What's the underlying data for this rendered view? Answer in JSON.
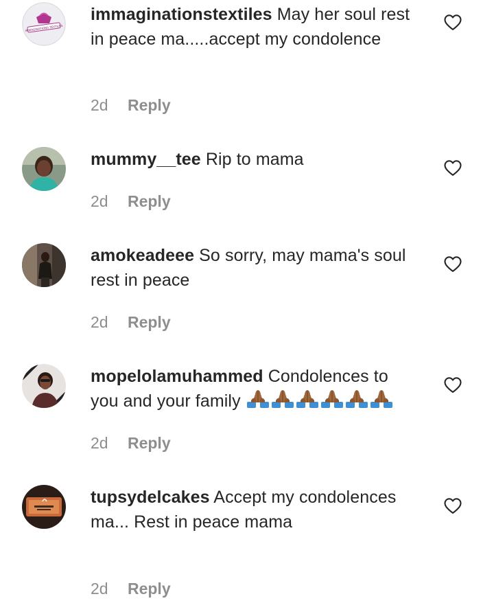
{
  "comments": [
    {
      "username": "immaginationstextiles",
      "text": "May her soul rest in peace ma.....accept my condolence",
      "time": "2d",
      "reply_label": "Reply",
      "avatar_icon": "textile-logo-avatar",
      "logo_text": "IMMAGINATIONS TEXTILES"
    },
    {
      "username": "mummy__tee",
      "text": "Rip to mama",
      "time": "2d",
      "reply_label": "Reply",
      "avatar_icon": "profile-photo-avatar"
    },
    {
      "username": "amokeadeee",
      "text": "So sorry, may mama's soul rest in peace",
      "time": "2d",
      "reply_label": "Reply",
      "avatar_icon": "profile-photo-avatar"
    },
    {
      "username": "mopelolamuhammed",
      "text": "Condolences to you and your family",
      "emoji": "🙏🏾🙏🏾🙏🏾🙏🏾🙏🏾🙏🏾",
      "emoji_count": 6,
      "time": "2d",
      "reply_label": "Reply",
      "avatar_icon": "profile-photo-avatar"
    },
    {
      "username": "tupsydelcakes",
      "text": "Accept my condolences ma... Rest in peace mama",
      "time": "2d",
      "reply_label": "Reply",
      "avatar_icon": "cake-brand-avatar"
    }
  ],
  "icons": {
    "like": "heart-outline-icon",
    "emoji": "folded-hands-emoji"
  },
  "colors": {
    "text": "#262626",
    "meta": "#8e8e8e",
    "background": "#ffffff"
  }
}
